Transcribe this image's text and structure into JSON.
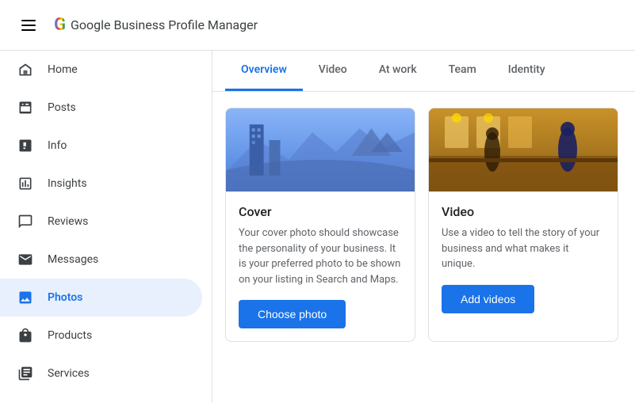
{
  "topbar": {
    "logo_text": "Google Business Profile Manager",
    "google_letter": "G"
  },
  "sidebar": {
    "items": [
      {
        "id": "home",
        "label": "Home",
        "icon": "home-icon",
        "active": false
      },
      {
        "id": "posts",
        "label": "Posts",
        "icon": "posts-icon",
        "active": false
      },
      {
        "id": "info",
        "label": "Info",
        "icon": "info-icon",
        "active": false
      },
      {
        "id": "insights",
        "label": "Insights",
        "icon": "insights-icon",
        "active": false
      },
      {
        "id": "reviews",
        "label": "Reviews",
        "icon": "reviews-icon",
        "active": false
      },
      {
        "id": "messages",
        "label": "Messages",
        "icon": "messages-icon",
        "active": false
      },
      {
        "id": "photos",
        "label": "Photos",
        "icon": "photos-icon",
        "active": true
      },
      {
        "id": "products",
        "label": "Products",
        "icon": "products-icon",
        "active": false
      },
      {
        "id": "services",
        "label": "Services",
        "icon": "services-icon",
        "active": false
      }
    ]
  },
  "tabs": [
    {
      "id": "overview",
      "label": "Overview",
      "active": true
    },
    {
      "id": "video",
      "label": "Video",
      "active": false
    },
    {
      "id": "at_work",
      "label": "At work",
      "active": false
    },
    {
      "id": "team",
      "label": "Team",
      "active": false
    },
    {
      "id": "identity",
      "label": "Identity",
      "active": false
    }
  ],
  "cards": [
    {
      "id": "cover",
      "title": "Cover",
      "description": "Your cover photo should showcase the personality of your business. It is your preferred photo to be shown on your listing in Search and Maps.",
      "button_label": "Choose photo",
      "type": "cover"
    },
    {
      "id": "video",
      "title": "Video",
      "description": "Use a video to tell the story of your business and what makes it unique.",
      "button_label": "Add videos",
      "type": "video"
    }
  ],
  "colors": {
    "accent": "#1a73e8",
    "active_bg": "#e8f0fe",
    "text_primary": "#202124",
    "text_secondary": "#5f6368"
  }
}
